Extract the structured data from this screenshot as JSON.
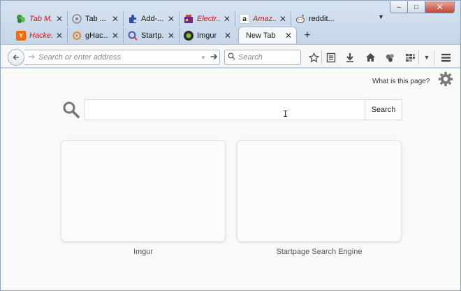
{
  "window": {
    "controls": {
      "minimize": "–",
      "maximize": "□",
      "close": "✕"
    }
  },
  "tabs": {
    "row1": [
      {
        "title": "Tab M...",
        "favicon": "tab-mix-favicon",
        "color": "#3a9a3a",
        "pending": true
      },
      {
        "title": "Tab ...",
        "favicon": "tab-group-favicon",
        "color": "#9a9a9a",
        "pending": false
      },
      {
        "title": "Add-...",
        "favicon": "addons-puzzle-favicon",
        "color": "#2a4fb0",
        "pending": false
      },
      {
        "title": "Electr...",
        "favicon": "electronics-favicon",
        "color": "#6b2d7a",
        "pending": true
      },
      {
        "title": "Amaz...",
        "favicon": "amazon-favicon",
        "color": "#222222",
        "pending": true
      },
      {
        "title": "reddit...",
        "favicon": "reddit-favicon",
        "color": "#ff4500",
        "pending": false
      }
    ],
    "row2": [
      {
        "title": "Hacke...",
        "favicon": "hacker-news-favicon",
        "color": "#ff6600",
        "pending": true
      },
      {
        "title": "gHac...",
        "favicon": "ghacks-favicon",
        "color": "#e0882a",
        "pending": false
      },
      {
        "title": "Startp...",
        "favicon": "startpage-favicon",
        "color": "#3b5bb8",
        "pending": false
      },
      {
        "title": "Imgur",
        "favicon": "imgur-favicon",
        "color": "#2b2b2b",
        "pending": false
      }
    ],
    "active": {
      "title": "New Tab"
    },
    "close_glyph": "✕",
    "new_tab_glyph": "+",
    "menu_glyph": "▼"
  },
  "toolbar": {
    "url_placeholder": "Search or enter address",
    "search_placeholder": "Search",
    "icons": [
      "bookmark-star-icon",
      "reading-list-icon",
      "downloads-icon",
      "home-icon",
      "pocket-icon",
      "bookmarks-menu-icon",
      "dropdown-icon",
      "hamburger-menu-icon"
    ]
  },
  "content": {
    "what_is_this": "What is this page?",
    "search_button": "Search",
    "tiles": [
      {
        "label": "Imgur"
      },
      {
        "label": "Startpage Search Engine"
      }
    ]
  }
}
